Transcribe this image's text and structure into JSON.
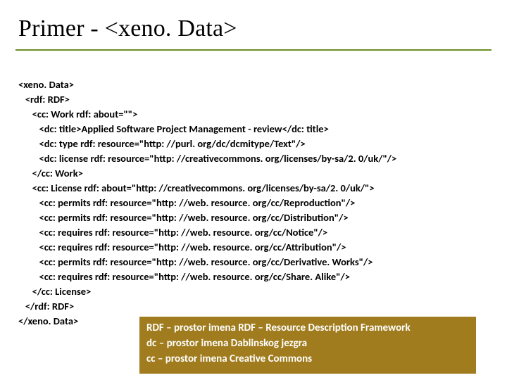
{
  "title": "Primer - <xeno. Data>",
  "code": "<xeno. Data>\n   <rdf: RDF>\n      <cc: Work rdf: about=\"\">\n         <dc: title>Applied Software Project Management - review</dc: title>\n         <dc: type rdf: resource=\"http: //purl. org/dc/dcmitype/Text\"/>\n         <dc: license rdf: resource=\"http: //creativecommons. org/licenses/by-sa/2. 0/uk/\"/>\n      </cc: Work>\n      <cc: License rdf: about=\"http: //creativecommons. org/licenses/by-sa/2. 0/uk/\">\n         <cc: permits rdf: resource=\"http: //web. resource. org/cc/Reproduction\"/>\n         <cc: permits rdf: resource=\"http: //web. resource. org/cc/Distribution\"/>\n         <cc: requires rdf: resource=\"http: //web. resource. org/cc/Notice\"/>\n         <cc: requires rdf: resource=\"http: //web. resource. org/cc/Attribution\"/>\n         <cc: permits rdf: resource=\"http: //web. resource. org/cc/Derivative. Works\"/>\n         <cc: requires rdf: resource=\"http: //web. resource. org/cc/Share. Alike\"/>\n      </cc: License>\n   </rdf: RDF>\n</xeno. Data>",
  "legend": {
    "line1": "RDF – prostor imena RDF – Resource Description Framework",
    "line2": "dc – prostor imena Dablinskog jezgra",
    "line3": "cc – prostor imena Creative Commons"
  }
}
